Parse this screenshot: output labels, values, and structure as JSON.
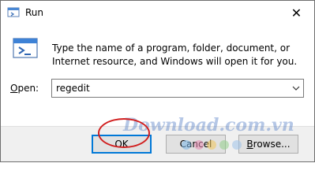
{
  "window": {
    "title": "Run",
    "close_glyph": "✕"
  },
  "content": {
    "description": "Type the name of a program, folder, document, or Internet resource, and Windows will open it for you.",
    "open_label_prefix": "O",
    "open_label_rest": "pen:",
    "open_value": "regedit"
  },
  "buttons": {
    "ok": "OK",
    "cancel": "Cancel",
    "browse_prefix": "B",
    "browse_rest": "rowse..."
  },
  "watermark": {
    "text": "Download.com.vn",
    "dot_colors": [
      "#7ab7e8",
      "#e88bb0",
      "#f3c65a",
      "#93d08a",
      "#9fc2e9"
    ]
  },
  "colors": {
    "focus_border": "#0078d7",
    "annotation": "#d11f1f"
  }
}
